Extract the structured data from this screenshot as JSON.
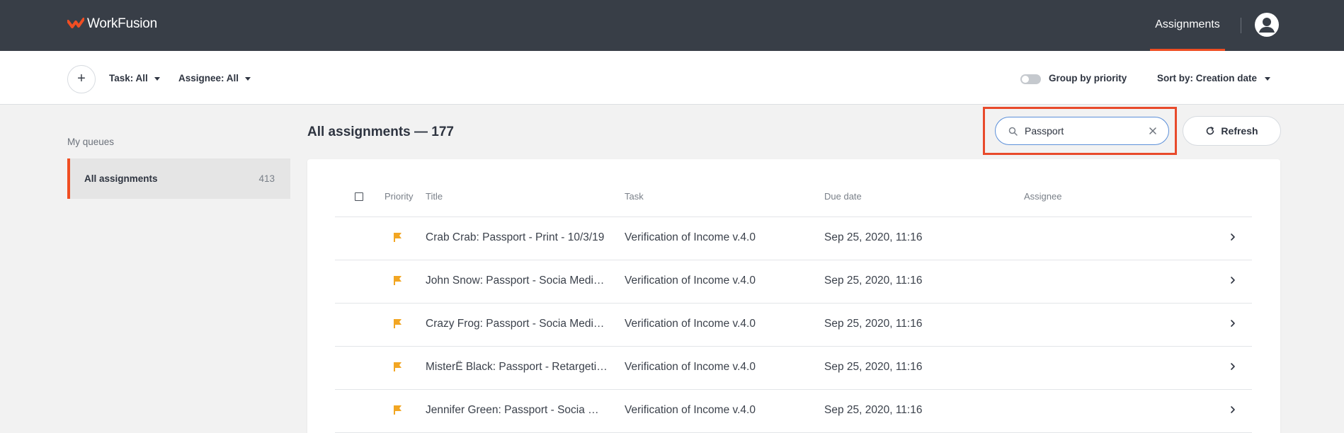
{
  "header": {
    "brand": "WorkFusion",
    "nav_tab": "Assignments",
    "accent_color": "#f04e23"
  },
  "filters": {
    "add_label": "+",
    "task_filter": "Task: All",
    "assignee_filter": "Assignee: All",
    "group_by_priority_label": "Group by priority",
    "group_by_priority_on": false,
    "sort_by": "Sort by: Creation date"
  },
  "sidebar": {
    "section_title": "My queues",
    "queues": [
      {
        "label": "All assignments",
        "count": "413"
      }
    ]
  },
  "content": {
    "title": "All assignments — 177",
    "search": {
      "value": "Passport",
      "placeholder": ""
    },
    "refresh_label": "Refresh"
  },
  "table": {
    "columns": {
      "priority": "Priority",
      "title": "Title",
      "task": "Task",
      "due": "Due date",
      "assignee": "Assignee"
    },
    "rows": [
      {
        "title": "Crab Crab: Passport - Print - 10/3/19",
        "task": "Verification of Income v.4.0",
        "due": "Sep 25, 2020, 11:16",
        "assignee": "",
        "priority_icon": "flag-icon"
      },
      {
        "title": "John Snow: Passport - Socia Medi…",
        "task": "Verification of Income v.4.0",
        "due": "Sep 25, 2020, 11:16",
        "assignee": "",
        "priority_icon": "flag-icon"
      },
      {
        "title": "Crazy Frog: Passport - Socia Medi…",
        "task": "Verification of Income v.4.0",
        "due": "Sep 25, 2020, 11:16",
        "assignee": "",
        "priority_icon": "flag-icon"
      },
      {
        "title": "MisterÊ Black: Passport - Retargeti…",
        "task": "Verification of Income v.4.0",
        "due": "Sep 25, 2020, 11:16",
        "assignee": "",
        "priority_icon": "flag-icon"
      },
      {
        "title": "Jennifer Green: Passport - Socia …",
        "task": "Verification of Income v.4.0",
        "due": "Sep 25, 2020, 11:16",
        "assignee": "",
        "priority_icon": "flag-icon"
      }
    ],
    "flag_color": "#f2a623"
  }
}
